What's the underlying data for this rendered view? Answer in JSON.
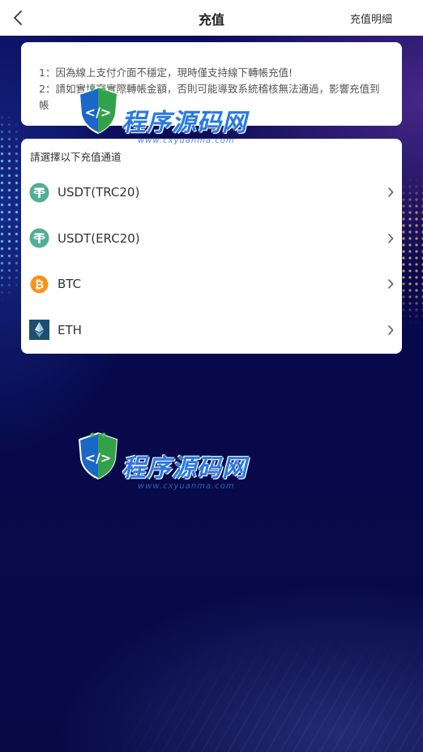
{
  "header": {
    "title": "充值",
    "history_label": "充值明細"
  },
  "notice": {
    "lines": [
      "1：因為線上支付介面不穩定，現時僅支持線下轉帳充值!",
      "2：請如實填寫實際轉帳金額，否則可能導致系統稽核無法通過，影響充值到帳"
    ]
  },
  "channels": {
    "heading": "請選擇以下充值通道",
    "items": [
      {
        "label": "USDT(TRC20)",
        "icon": "usdt-icon",
        "color": "#50af95"
      },
      {
        "label": "USDT(ERC20)",
        "icon": "usdt-icon",
        "color": "#50af95"
      },
      {
        "label": "BTC",
        "icon": "btc-icon",
        "color": "#f7931a"
      },
      {
        "label": "ETH",
        "icon": "eth-icon",
        "color": "#1e4f6e"
      }
    ]
  },
  "watermark": {
    "name": "程序源码网",
    "url": "www.cxyuanma.com"
  },
  "colors": {
    "background": "#07094a",
    "card": "#ffffff",
    "brand": "#2a79e3"
  }
}
